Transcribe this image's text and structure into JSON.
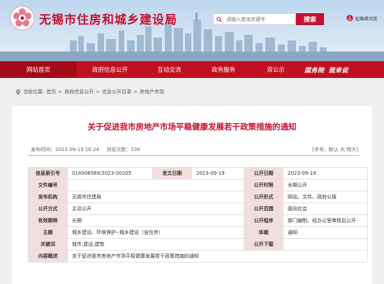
{
  "header": {
    "site_title": "无锡市住房和城乡建设局",
    "search_placeholder": "请输入查询关键字",
    "search_button": "搜索",
    "accessibility_label": "无障碍浏览"
  },
  "nav": {
    "items": [
      "网站首页",
      "政府信息公开",
      "互动交流",
      "政务服务",
      "双公示"
    ],
    "badges": [
      "国务院",
      "我来说"
    ]
  },
  "breadcrumb": {
    "prefix": "当前位置:",
    "items": [
      "首页",
      "政府信息公开",
      "信息公开目录",
      "房地产市场"
    ],
    "separator": ">"
  },
  "article": {
    "title": "关于促进我市房地产市场平稳健康发展若干政策措施的通知",
    "publish_time": "发布时间：2023-09-19 16:24",
    "views": "浏览次数：536",
    "font_size_control": "[字号：默认 大 特大]"
  },
  "info_table": {
    "rows": [
      [
        "信息索引号",
        "014006569/2023-00205",
        "发文日期",
        "2023-09-19",
        "公开日期",
        "2023-09-19"
      ],
      [
        "文件编号",
        "",
        "公开时限",
        "长期公开"
      ],
      [
        "发布机构",
        "无锡市住建局",
        "公开形式",
        "网站、文件、政府公报"
      ],
      [
        "公开方式",
        "主动公开",
        "公开范围",
        "面向社会"
      ],
      [
        "有效期限",
        "长期",
        "公开程序",
        "部门编制、经办公室审核后公开"
      ],
      [
        "主题",
        "城乡建设、环境保护--城乡建设（含住房）",
        "体裁",
        "通知"
      ],
      [
        "关键词",
        "城市,建设,建筑",
        "公开下载",
        ""
      ],
      [
        "内容概述",
        "关于促进我市房地产市场平稳健康发展若干政策措施的通知"
      ]
    ]
  },
  "colors": {
    "brand_red": "#c8102e",
    "nav_red": "#c0101f",
    "label_bg": "#f3dede"
  }
}
